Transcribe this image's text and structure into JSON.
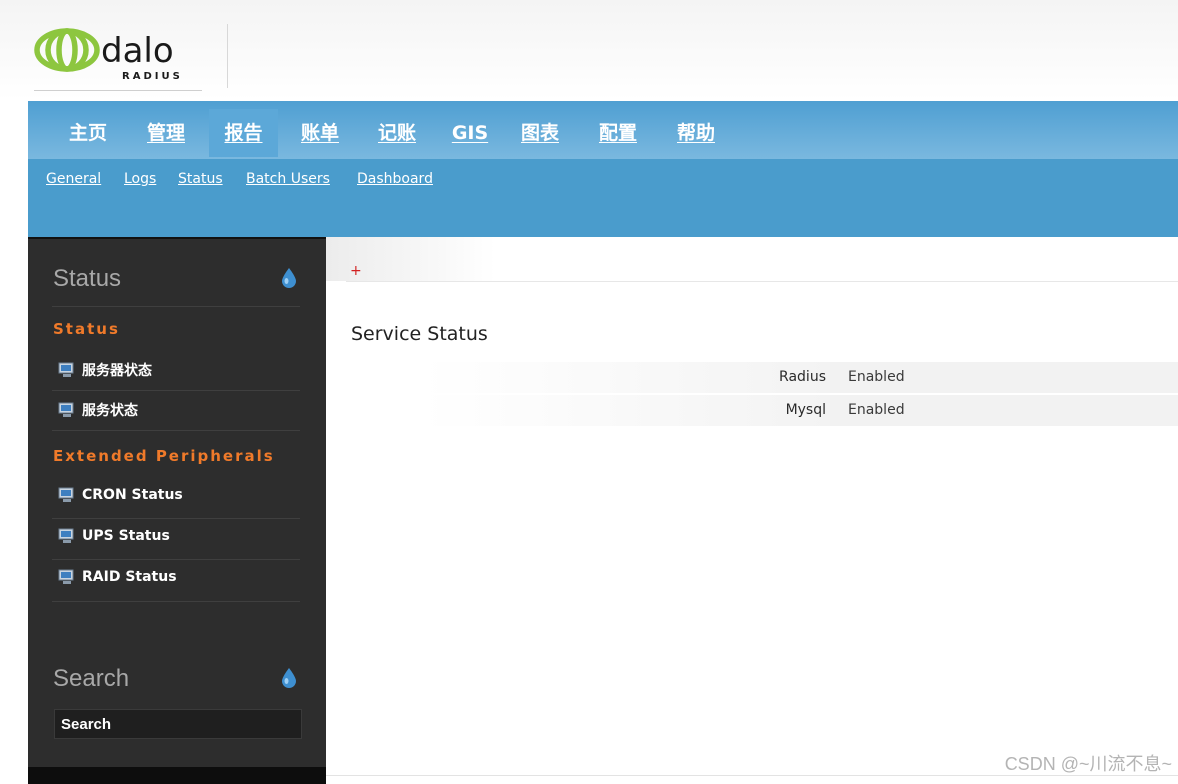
{
  "logo": {
    "wordmark": "dalo",
    "tagline": "RADIUS"
  },
  "nav": {
    "items": [
      {
        "label": "主页"
      },
      {
        "label": "管理"
      },
      {
        "label": "报告"
      },
      {
        "label": "账单"
      },
      {
        "label": "记账"
      },
      {
        "label": "GIS"
      },
      {
        "label": "图表"
      },
      {
        "label": "配置"
      },
      {
        "label": "帮助"
      }
    ],
    "active": "报告",
    "sub_items": [
      {
        "label": "General"
      },
      {
        "label": "Logs"
      },
      {
        "label": "Status"
      },
      {
        "label": "Batch Users"
      },
      {
        "label": "Dashboard"
      }
    ]
  },
  "sidebar": {
    "heading": "Status",
    "sections": [
      {
        "title": "Status",
        "links": [
          {
            "label": "服务器状态"
          },
          {
            "label": "服务状态"
          }
        ]
      },
      {
        "title": "Extended Peripherals",
        "links": [
          {
            "label": "CRON Status"
          },
          {
            "label": "UPS Status"
          },
          {
            "label": "RAID Status"
          }
        ]
      }
    ],
    "search_heading": "Search",
    "search_placeholder": "Search"
  },
  "main": {
    "expand_symbol": "+",
    "section_title": "Service Status",
    "services": [
      {
        "name": "Radius",
        "status": "Enabled"
      },
      {
        "name": "Mysql",
        "status": "Enabled"
      }
    ]
  },
  "watermark": "CSDN @~川流不息~",
  "colors": {
    "nav_blue": "#4a9ccc",
    "sidebar_bg": "#2d2d2d",
    "section_orange": "#f07a2a",
    "logo_green": "#8dc63f"
  }
}
